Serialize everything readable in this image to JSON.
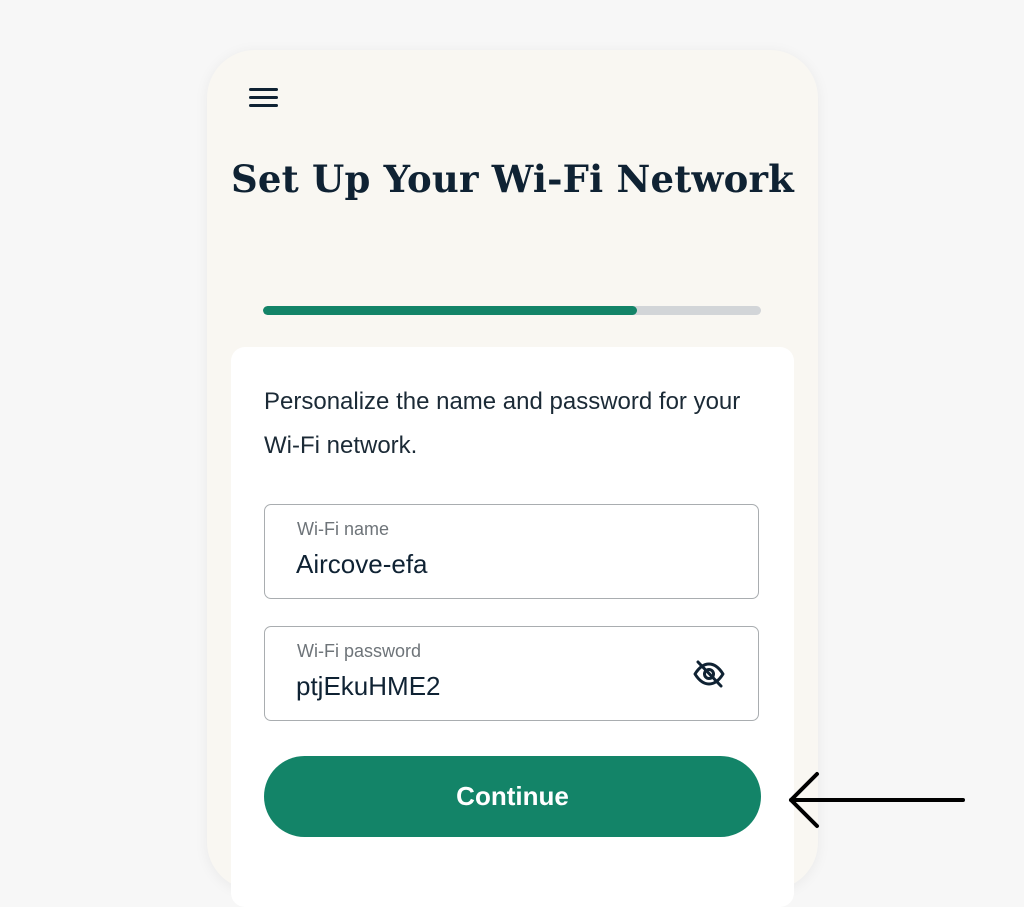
{
  "header": {
    "menu_icon": "hamburger-menu-icon",
    "title": "Set Up Your Wi-Fi Network"
  },
  "progress": {
    "fraction": 0.75,
    "fill_color": "#138468",
    "track_color": "#d2d5d8"
  },
  "form": {
    "description": "Personalize the name and password for your Wi-Fi network.",
    "wifi_name": {
      "label": "Wi-Fi name",
      "value": "Aircove-efa"
    },
    "wifi_password": {
      "label": "Wi-Fi password",
      "value": "ptjEkuHME2",
      "toggle_icon": "eye-slash-icon"
    },
    "continue_label": "Continue"
  },
  "annotation": {
    "icon": "left-arrow-icon",
    "color": "#000000"
  },
  "colors": {
    "accent": "#138468",
    "page_background": "#f7f7f7",
    "panel_background": "#f9f7f2",
    "title_text": "#0f2233"
  }
}
